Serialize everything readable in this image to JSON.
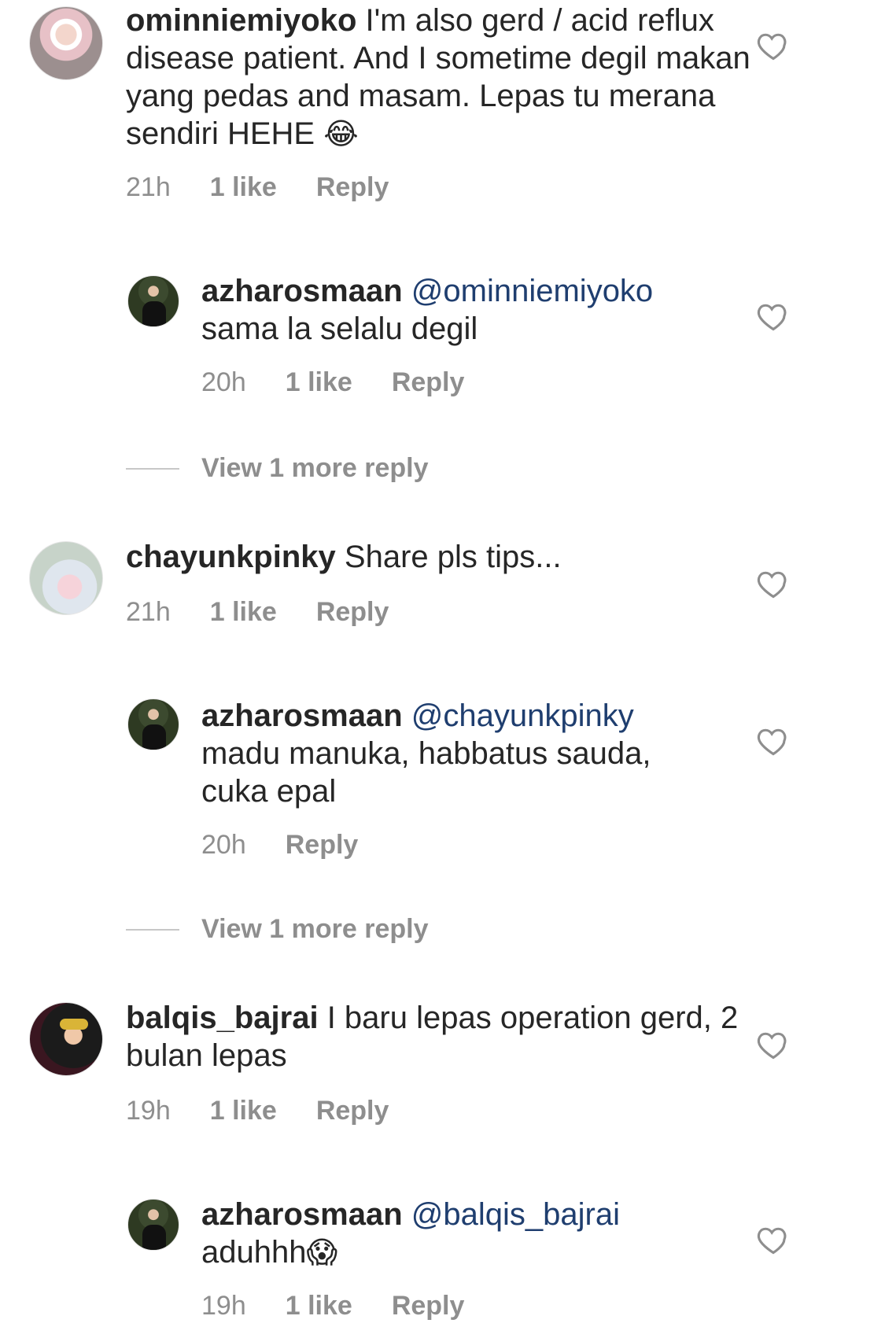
{
  "comments": [
    {
      "username": "ominniemiyoko",
      "text": "I'm also gerd / acid reflux disease patient. And I sometime degil makan yang pedas and masam. Lepas tu merana sendiri HEHE",
      "emoji": "😂",
      "time": "21h",
      "likes": "1 like",
      "reply_label": "Reply",
      "replies": [
        {
          "username": "azharosmaan",
          "mention": "@ominniemiyoko",
          "text": "sama la selalu degil",
          "time": "20h",
          "likes": "1 like",
          "reply_label": "Reply"
        }
      ],
      "view_more": "View 1 more reply"
    },
    {
      "username": "chayunkpinky",
      "text": "Share pls tips...",
      "time": "21h",
      "likes": "1 like",
      "reply_label": "Reply",
      "replies": [
        {
          "username": "azharosmaan",
          "mention": "@chayunkpinky",
          "text": "madu manuka, habbatus sauda, cuka epal",
          "time": "20h",
          "reply_label": "Reply"
        }
      ],
      "view_more": "View 1 more reply"
    },
    {
      "username": "balqis_bajrai",
      "text": "I baru lepas operation gerd, 2 bulan lepas",
      "time": "19h",
      "likes": "1 like",
      "reply_label": "Reply",
      "replies": [
        {
          "username": "azharosmaan",
          "mention": "@balqis_bajrai",
          "text": "aduhhh",
          "emoji": "😱",
          "time": "19h",
          "likes": "1 like",
          "reply_label": "Reply"
        }
      ]
    }
  ],
  "icons": {
    "like": "heart-outline-icon"
  },
  "colors": {
    "text": "#262626",
    "muted": "#8e8e8e",
    "mention": "#1f3e6f"
  }
}
